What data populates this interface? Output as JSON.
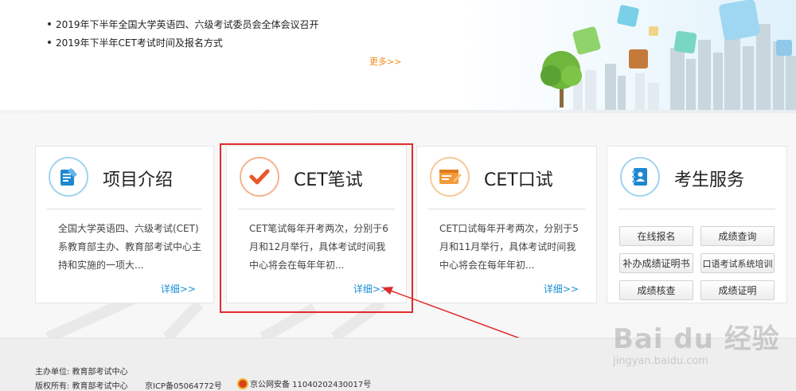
{
  "news": {
    "items": [
      "2019年下半年全国大学英语四、六级考试委员会全体会议召开",
      "2019年下半年CET考试时间及报名方式"
    ],
    "more_label": "更多>>"
  },
  "cards": [
    {
      "title": "项目介绍",
      "desc": "全国大学英语四、六级考试(CET)系教育部主办、教育部考试中心主持和实施的一项大...",
      "detail": "详细>>",
      "icon": "document-icon"
    },
    {
      "title": "CET笔试",
      "desc": "CET笔试每年开考两次，分别于6月和12月举行，具体考试时间我中心将会在每年年初...",
      "detail": "详细>>",
      "icon": "checkmark-icon"
    },
    {
      "title": "CET口试",
      "desc": "CET口试每年开考两次，分别于5月和11月举行，具体考试时间我中心将会在每年年初...",
      "detail": "详细>>",
      "icon": "form-icon"
    },
    {
      "title": "考生服务",
      "icon": "contacts-book-icon",
      "buttons": [
        "在线报名",
        "成绩查询",
        "补办成绩证明书",
        "口语考试系统培训",
        "成绩核查",
        "成绩证明"
      ]
    }
  ],
  "footer": {
    "host": "主办单位:  教育部考试中心",
    "copyright": "版权所有:  教育部考试中心",
    "icp": "京ICP备05064772号",
    "police": "京公网安备 11040202430017号"
  },
  "watermark": {
    "brand": "Bai du 经验",
    "url": "jingyan.baidu.com"
  },
  "colors": {
    "accent_orange": "#f08c1a",
    "link_blue": "#1a8fd6",
    "highlight_red": "#e02b2b"
  }
}
